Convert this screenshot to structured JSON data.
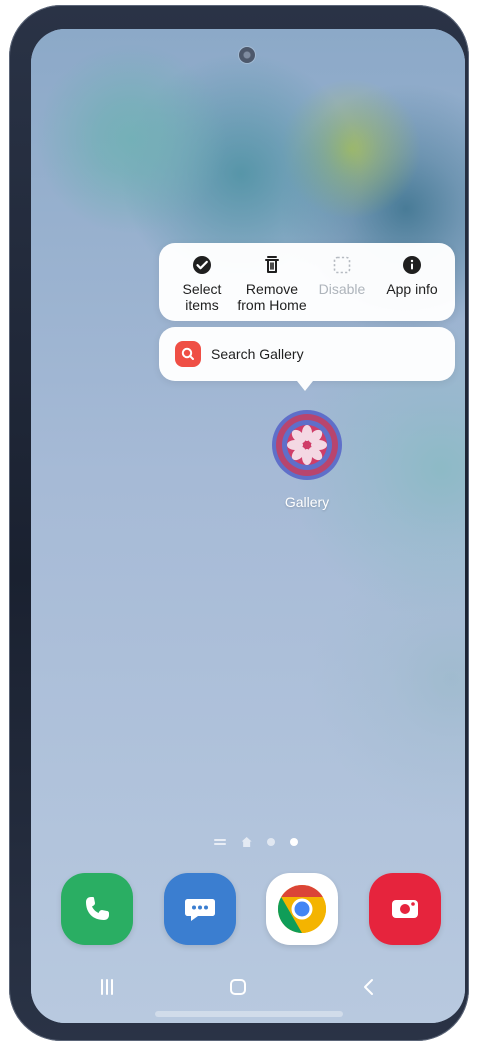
{
  "context_menu": {
    "items": [
      {
        "label_line1": "Select",
        "label_line2": "items",
        "icon": "check-circle-icon"
      },
      {
        "label_line1": "Remove",
        "label_line2": "from Home",
        "icon": "trash-icon"
      },
      {
        "label_line1": "Disable",
        "label_line2": "",
        "icon": "disabled-square-icon"
      },
      {
        "label_line1": "App info",
        "label_line2": "",
        "icon": "info-icon"
      }
    ],
    "search_action": "Search Gallery"
  },
  "home_screen": {
    "selected_app": "Gallery"
  },
  "colors": {
    "accent_red": "#ef4f45",
    "phone_green": "#2aae63",
    "messages_blue": "#3b7ed0",
    "camera_red": "#e6243d"
  },
  "dock": {
    "apps": [
      {
        "name": "Phone",
        "icon": "phone-icon"
      },
      {
        "name": "Messages",
        "icon": "messages-icon"
      },
      {
        "name": "Chrome",
        "icon": "chrome-icon"
      },
      {
        "name": "Camera",
        "icon": "camera-icon"
      }
    ]
  }
}
